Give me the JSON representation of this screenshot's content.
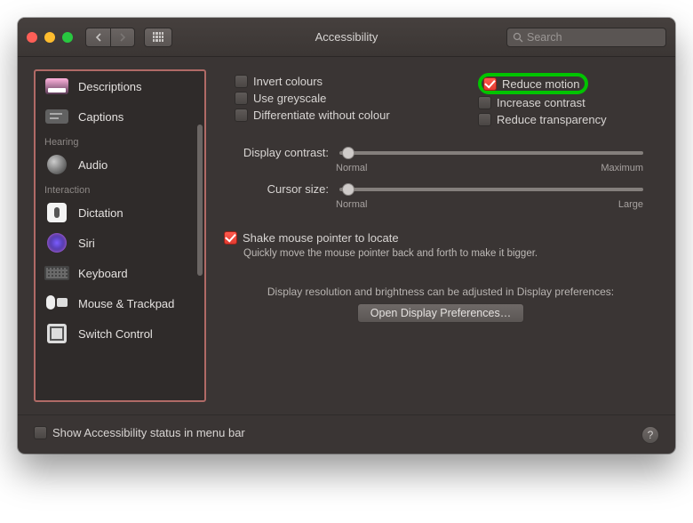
{
  "window": {
    "title": "Accessibility"
  },
  "search": {
    "placeholder": "Search"
  },
  "sidebar": {
    "items": [
      {
        "label": "Descriptions"
      },
      {
        "label": "Captions"
      }
    ],
    "hearing_label": "Hearing",
    "hearing_items": [
      {
        "label": "Audio"
      }
    ],
    "interaction_label": "Interaction",
    "interaction_items": [
      {
        "label": "Dictation"
      },
      {
        "label": "Siri"
      },
      {
        "label": "Keyboard"
      },
      {
        "label": "Mouse & Trackpad"
      },
      {
        "label": "Switch Control"
      }
    ]
  },
  "options": {
    "invert_colours": "Invert colours",
    "use_greyscale": "Use greyscale",
    "differentiate": "Differentiate without colour",
    "reduce_motion": "Reduce motion",
    "increase_contrast": "Increase contrast",
    "reduce_transparency": "Reduce transparency"
  },
  "sliders": {
    "contrast_label": "Display contrast:",
    "contrast_min": "Normal",
    "contrast_max": "Maximum",
    "cursor_label": "Cursor size:",
    "cursor_min": "Normal",
    "cursor_max": "Large"
  },
  "shake": {
    "label": "Shake mouse pointer to locate",
    "desc": "Quickly move the mouse pointer back and forth to make it bigger."
  },
  "display_note": "Display resolution and brightness can be adjusted in Display preferences:",
  "open_display_btn": "Open Display Preferences…",
  "footer": {
    "menu_bar_label": "Show Accessibility status in menu bar"
  }
}
